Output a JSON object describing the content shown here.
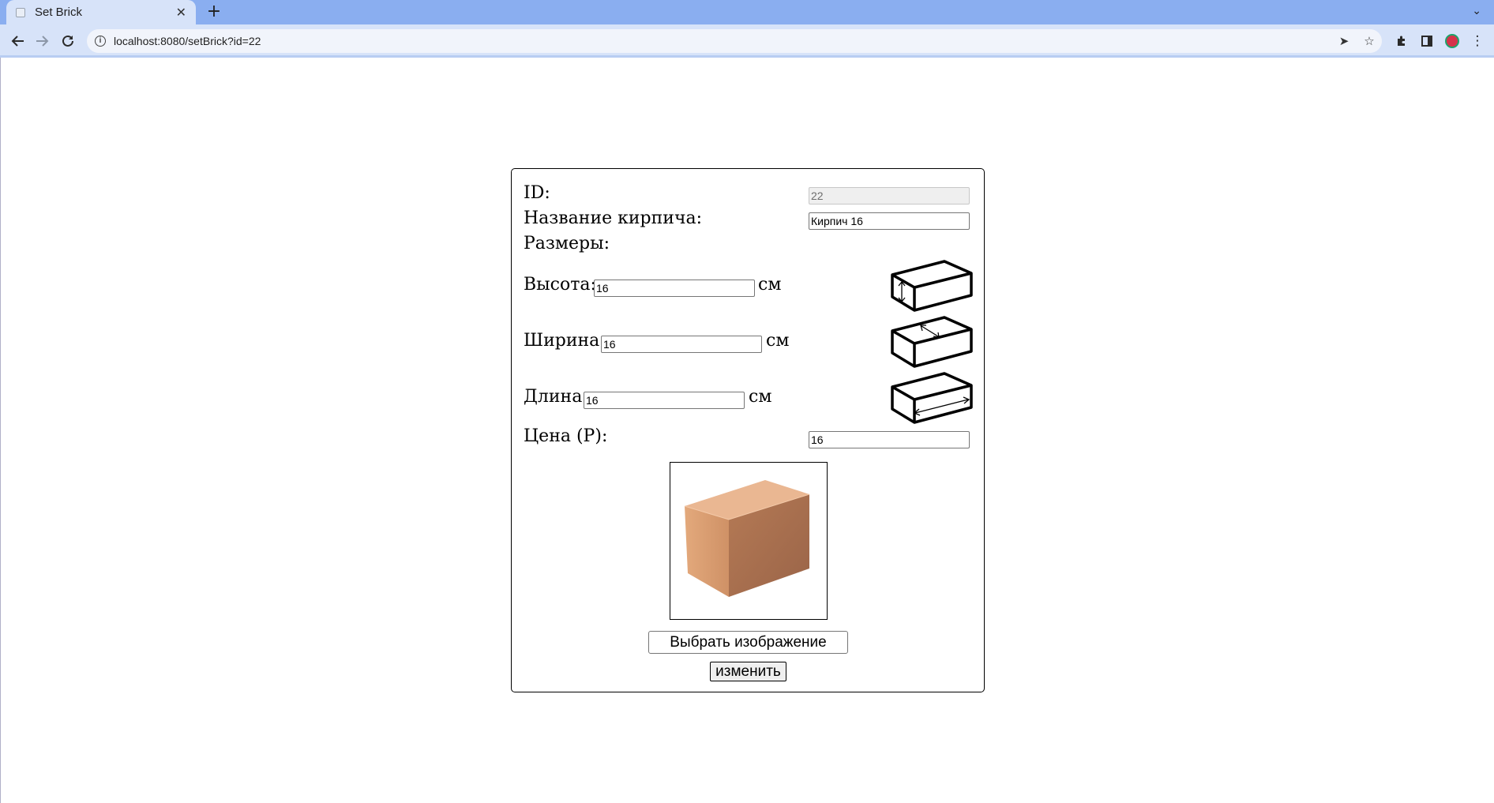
{
  "browser": {
    "tab_title": "Set Brick",
    "url": "localhost:8080/setBrick?id=22"
  },
  "form": {
    "id_label": "ID:",
    "id_value": "22",
    "name_label": "Название кирпича:",
    "name_value": "Кирпич 16",
    "dimensions_label": "Размеры:",
    "height_label": "Высота:",
    "height_value": "16",
    "width_label": "Ширина:",
    "width_value": "16",
    "length_label": "Длина:",
    "length_value": "16",
    "unit": "см",
    "price_label": "Цена (Р):",
    "price_value": "16",
    "choose_image_label": "Выбрать изображение",
    "submit_label": "изменить"
  },
  "icons": {
    "height_diagram": "brick-height-arrow-icon",
    "width_diagram": "brick-width-arrow-icon",
    "length_diagram": "brick-length-arrow-icon"
  },
  "colors": {
    "tabstrip": "#8aaef0",
    "toolbar": "#d7e3f9",
    "brick_face": "#c98b5e"
  }
}
